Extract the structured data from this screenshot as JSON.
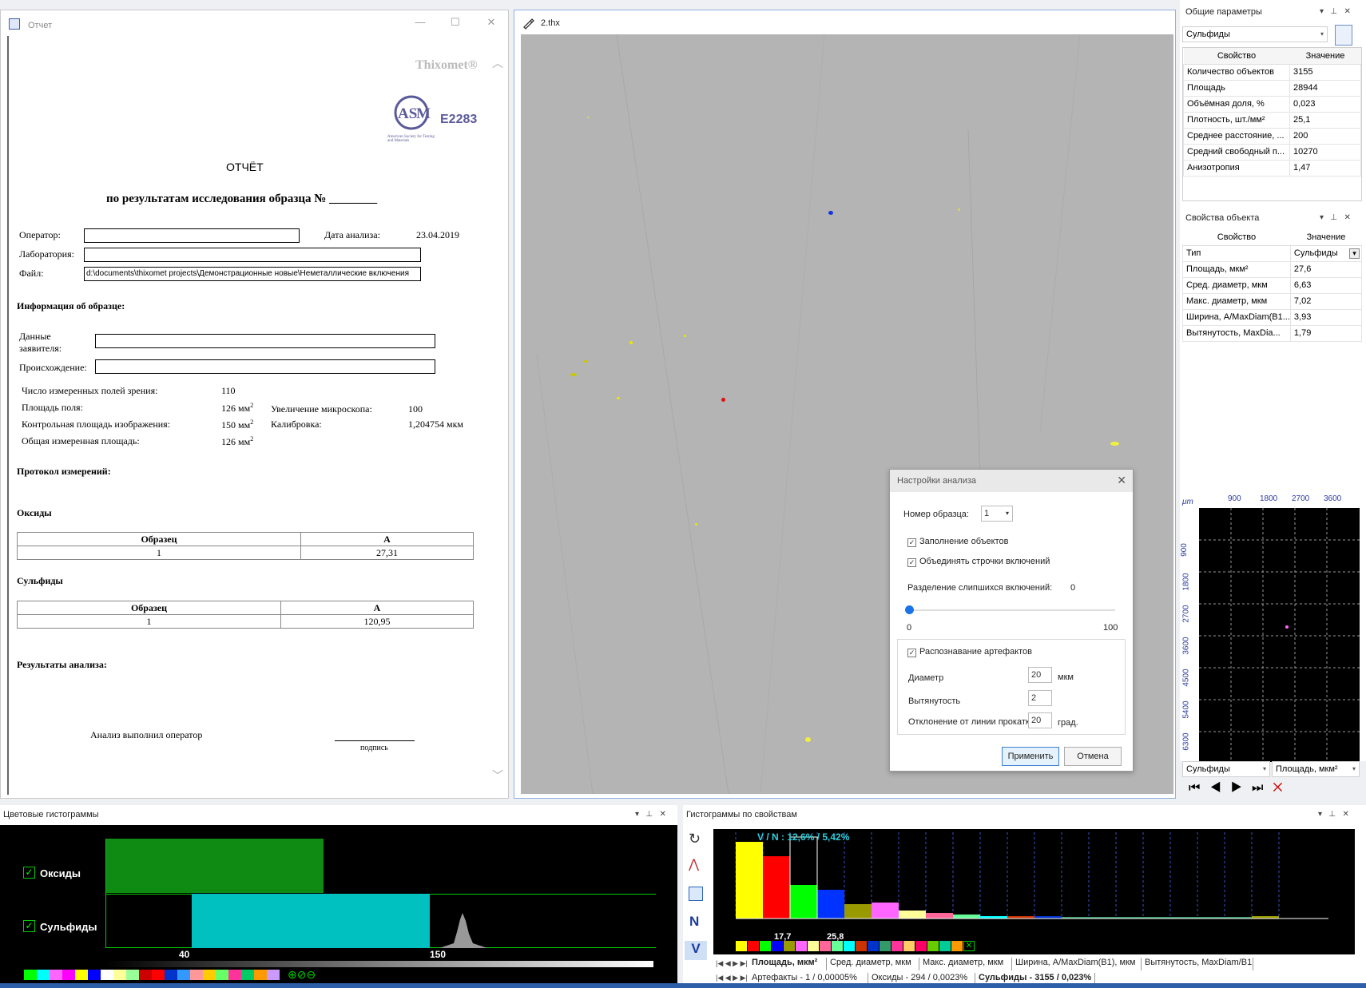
{
  "report": {
    "window_title": "Отчет",
    "brand": "Thixomet®",
    "standard": "E2283",
    "astm_caption": "American Society for Testing and Materials",
    "heading": "ОТЧЁТ",
    "subheading": "по результатам исследования образца № ________",
    "operator_label": "Оператор:",
    "operator_value": "",
    "date_label": "Дата анализа:",
    "date_value": "23.04.2019",
    "lab_label": "Лаборатория:",
    "lab_value": "",
    "file_label": "Файл:",
    "file_value": "d:\\documents\\thixomet projects\\Демонстрационные новые\\Неметаллические включения",
    "sample_info_title": "Информация об образце:",
    "applicant_label_1": "Данные",
    "applicant_label_2": "заявителя:",
    "origin_label": "Происхождение:",
    "fields_count_label": "Число измеренных полей зрения:",
    "fields_count_value": "110",
    "field_area_label": "Площадь поля:",
    "field_area_value": "126 мм",
    "control_area_label": "Контрольная площадь изображения:",
    "control_area_value": "150 мм",
    "total_area_label": "Общая измеренная площадь:",
    "total_area_value": "126 мм",
    "sup2": "2",
    "magnification_label": "Увеличение микроскопа:",
    "magnification_value": "100",
    "calibration_label": "Калибровка:",
    "calibration_value": "1,204754 мкм",
    "protocol_title": "Протокол измерений:",
    "oxides_title": "Оксиды",
    "oxides_table": {
      "h1": "Образец",
      "h2": "A",
      "c1": "1",
      "c2": "27,31"
    },
    "sulfides_title": "Сульфиды",
    "sulfides_table": {
      "h1": "Образец",
      "h2": "A",
      "c1": "1",
      "c2": "120,95"
    },
    "results_title": "Результаты анализа:",
    "done_by": "Анализ выполнил оператор",
    "signature": "подпись"
  },
  "image_window": {
    "title": "2.thx"
  },
  "dialog": {
    "title": "Настройки анализа",
    "sample_no_label": "Номер образца:",
    "sample_no_value": "1",
    "fill_objects": "Заполнение объектов",
    "merge_rows": "Объединять строчки включений",
    "separation_label": "Разделение слипшихся включений:",
    "separation_value": "0",
    "slider_min": "0",
    "slider_max": "100",
    "slider_fraction": 0,
    "artifacts_label": "Распознавание артефактов",
    "diameter_label": "Диаметр",
    "diameter_value": "20",
    "diameter_unit": "мкм",
    "elongation_label": "Вытянутость",
    "elongation_value": "2",
    "deviation_label": "Отклонение от линии прокатки",
    "deviation_value": "20",
    "deviation_unit": "град.",
    "apply": "Применить",
    "cancel": "Отмена"
  },
  "general_params": {
    "title": "Общие параметры",
    "selector": "Сульфиды",
    "col_property": "Свойство",
    "col_value": "Значение",
    "rows": [
      {
        "p": "Количество объектов",
        "v": "3155"
      },
      {
        "p": "Площадь",
        "v": "28944"
      },
      {
        "p": "Объёмная доля, %",
        "v": "0,023"
      },
      {
        "p": "Плотность, шт./мм²",
        "v": "25,1"
      },
      {
        "p": "Среднее расстояние, ...",
        "v": "200"
      },
      {
        "p": "Средний свободный п...",
        "v": "10270"
      },
      {
        "p": "Анизотропия",
        "v": "1,47"
      }
    ]
  },
  "object_props": {
    "title": "Свойства объекта",
    "col_property": "Свойство",
    "col_value": "Значение",
    "rows": [
      {
        "p": "Тип",
        "v": "Сульфиды"
      },
      {
        "p": "Площадь, мкм²",
        "v": "27,6"
      },
      {
        "p": "Сред. диаметр, мкм",
        "v": "6,63"
      },
      {
        "p": "Макс. диаметр, мкм",
        "v": "7,02"
      },
      {
        "p": "Ширина, A/MaxDiam(B1...",
        "v": "3,93"
      },
      {
        "p": "Вытянутость, MaxDia...",
        "v": "1,79"
      }
    ]
  },
  "minimap": {
    "unit": "μm",
    "top_ticks": [
      "900",
      "1800",
      "2700",
      "3600"
    ],
    "left_ticks": [
      "900",
      "1800",
      "2700",
      "3600",
      "4500",
      "5400",
      "6300"
    ],
    "selector_left": "Сульфиды",
    "selector_right": "Площадь, мкм²"
  },
  "color_hist": {
    "title": "Цветовые гистограммы",
    "oxides": "Оксиды",
    "sulfides": "Сульфиды",
    "tick_40": "40",
    "tick_150": "150"
  },
  "prop_hist": {
    "title": "Гистограммы по свойствам",
    "vn_label": "V / N : 12,6% / 5,42%",
    "mark_1": "17,7",
    "mark_2": "25,8",
    "tool_n": "N",
    "tool_v": "V",
    "property_tabs": [
      "Площадь, мкм²",
      "Сред. диаметр, мкм",
      "Макс. диаметр, мкм",
      "Ширина, A/MaxDiam(B1), мкм",
      "Вытянутость, MaxDiam/B1"
    ],
    "class_tabs": [
      "Артефакты - 1 / 0,00005%",
      "Оксиды - 294 / 0,0023%",
      "Сульфиды - 3155 / 0,023%"
    ]
  },
  "colors": {
    "accent": "#2d5fa8",
    "oxide_bar": "#0f8a12",
    "sulfide_bar": "#00c0c0",
    "hist_yellow": "#ffff00",
    "hist_red": "#ff0000",
    "hist_green": "#00e000",
    "hist_blue": "#0033ff"
  }
}
